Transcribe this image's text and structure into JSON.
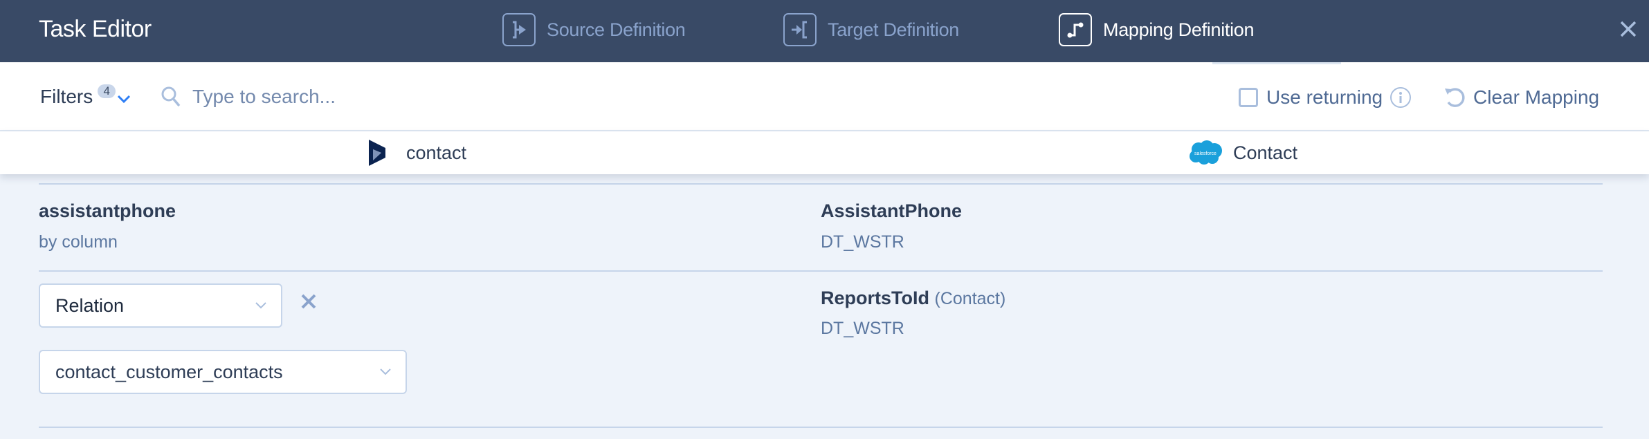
{
  "header": {
    "title": "Task Editor",
    "steps": [
      {
        "label": "Source Definition",
        "icon": "source-definition-icon",
        "active": false
      },
      {
        "label": "Target Definition",
        "icon": "target-definition-icon",
        "active": false
      },
      {
        "label": "Mapping Definition",
        "icon": "mapping-definition-icon",
        "active": true
      }
    ],
    "close_icon": "close-icon"
  },
  "toolbar": {
    "filters_label": "Filters",
    "filters_count": "4",
    "search_placeholder": "Type to search...",
    "search_value": "",
    "use_returning_label": "Use returning",
    "use_returning_checked": false,
    "clear_mapping_label": "Clear Mapping"
  },
  "entities": {
    "source": {
      "label": "contact",
      "icon": "dynamics-logo-icon"
    },
    "target": {
      "label": "Contact",
      "icon": "salesforce-logo-icon",
      "logo_text": "salesforce"
    }
  },
  "mappings": [
    {
      "source_name": "assistantphone",
      "source_mode": "by column",
      "target_name": "AssistantPhone",
      "target_type": "DT_WSTR"
    },
    {
      "source_mode_select": "Relation",
      "relation_select": "contact_customer_contacts",
      "target_name": "ReportsToId",
      "target_ref": "(Contact)",
      "target_type": "DT_WSTR"
    }
  ],
  "colors": {
    "header_bg": "#394a66",
    "accent_blue": "#2f7ff5",
    "muted_text": "#5b77a0",
    "salesforce_blue": "#1aa0db",
    "dynamics_navy": "#0b2350"
  }
}
